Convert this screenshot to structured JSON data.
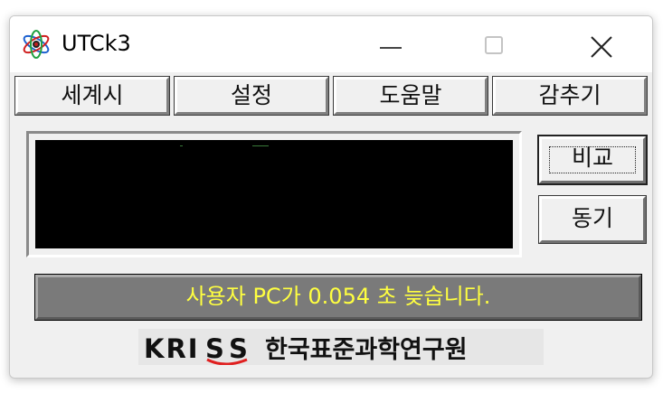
{
  "window": {
    "title": "UTCk3",
    "icon": "atom-icon",
    "controls": [
      "minimize-icon",
      "maximize-icon",
      "close-icon"
    ]
  },
  "menu": {
    "items": [
      {
        "label": "세계시"
      },
      {
        "label": "설정"
      },
      {
        "label": "도움말"
      },
      {
        "label": "감추기"
      }
    ]
  },
  "side_buttons": {
    "compare_label": "비교",
    "sync_label": "동기"
  },
  "status": {
    "message": "사용자 PC가 0.054 초 늦습니다."
  },
  "logo": {
    "brand": "KRISS",
    "institute": "한국표준과학연구원"
  },
  "colors": {
    "status_text": "#ffff40",
    "status_bg": "#7a7a7a",
    "display_bg": "#000000",
    "logo_red": "#e02020"
  }
}
